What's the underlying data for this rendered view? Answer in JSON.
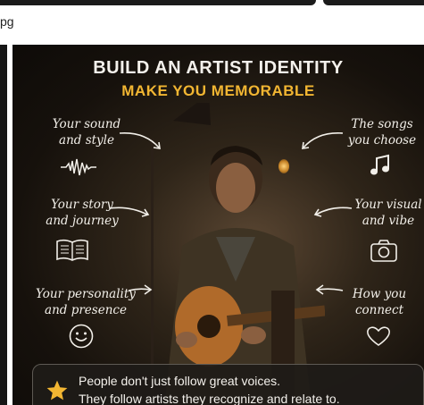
{
  "filename_fragment": "pg",
  "poster": {
    "title": "BUILD AN ARTIST IDENTITY",
    "subtitle": "MAKE YOU MEMORABLE",
    "features": {
      "sound_line1": "Your sound",
      "sound_line2": "and style",
      "songs_line1": "The songs",
      "songs_line2": "you choose",
      "story_line1": "Your story",
      "story_line2": "and journey",
      "visual_line1": "Your visual",
      "visual_line2": "and vibe",
      "personality_line1": "Your personality",
      "personality_line2": "and presence",
      "connect_line1": "How you",
      "connect_line2": "connect"
    },
    "callout": {
      "line1": "People don't just follow great voices.",
      "line2": "They follow artists they recognize and relate to."
    },
    "accent_color": "#f2b632"
  }
}
